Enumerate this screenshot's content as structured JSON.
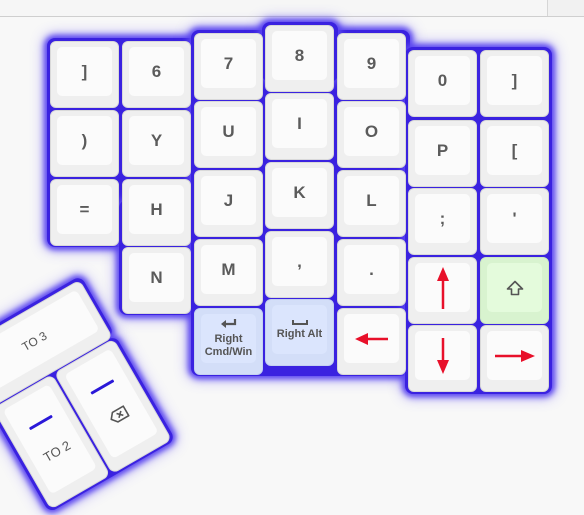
{
  "layout_name": "split keyboard right half",
  "colors": {
    "glow": "#3a22e0",
    "key_face": "#fbfbfb",
    "key_edge": "#efefef",
    "modifier_blue": "#dbe5fd",
    "shift_green": "#e4fbdc",
    "arrow_red": "#e8102a",
    "layer_bar": "#2a18d8"
  },
  "columns": [
    {
      "keys": [
        "]",
        ")",
        "="
      ]
    },
    {
      "keys": [
        "6",
        "Y",
        "H",
        "N"
      ]
    },
    {
      "keys": [
        "7",
        "U",
        "J",
        "M",
        "Right Cmd/Win"
      ]
    },
    {
      "keys": [
        "8",
        "I",
        "K",
        ",",
        "Right Alt"
      ]
    },
    {
      "keys": [
        "9",
        "O",
        "L",
        ".",
        "Left Arrow"
      ]
    },
    {
      "keys": [
        "0",
        "P",
        ";",
        "Up Arrow",
        "Down Arrow"
      ]
    },
    {
      "keys": [
        "]",
        "[",
        "'",
        "Shift",
        "Right Arrow"
      ]
    }
  ],
  "keys": {
    "c0r0": "]",
    "c0r1": ")",
    "c0r2": "=",
    "c1r0": "6",
    "c1r1": "Y",
    "c1r2": "H",
    "c1r3": "N",
    "c2r0": "7",
    "c2r1": "U",
    "c2r2": "J",
    "c2r3": "M",
    "c2r4": {
      "icon": "enter-icon",
      "line1": "Right",
      "line2": "Cmd/Win"
    },
    "c3r0": "8",
    "c3r1": "I",
    "c3r2": "K",
    "c3r3": ",",
    "c3r4": {
      "icon": "space-icon",
      "label": "Right Alt"
    },
    "c4r0": "9",
    "c4r1": "O",
    "c4r2": "L",
    "c4r3": ".",
    "c4r4": {
      "icon": "arrow-left-icon"
    },
    "c5r0": "0",
    "c5r1": "P",
    "c5r2": ";",
    "c5r3": {
      "icon": "arrow-up-icon"
    },
    "c5r4": {
      "icon": "arrow-down-icon"
    },
    "c6r0": "]",
    "c6r1": "[",
    "c6r2": "'",
    "c6r3": {
      "icon": "shift-icon"
    },
    "c6r4": {
      "icon": "arrow-right-icon"
    }
  },
  "thumb": {
    "to3": "TO 3",
    "to2": "TO 2",
    "backspace": {
      "icon": "backspace-icon"
    }
  }
}
